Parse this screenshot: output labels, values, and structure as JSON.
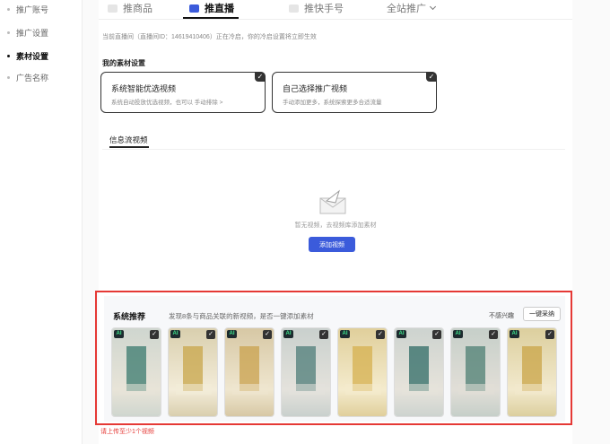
{
  "sidebar": {
    "items": [
      {
        "label": "推广账号",
        "active": false
      },
      {
        "label": "推广设置",
        "active": false
      },
      {
        "label": "素材设置",
        "active": true
      },
      {
        "label": "广告名称",
        "active": false
      }
    ]
  },
  "tabs": [
    {
      "label": "推商品",
      "active": false
    },
    {
      "label": "推直播",
      "active": true
    },
    {
      "label": "推快手号",
      "active": false
    },
    {
      "label": "全站推广",
      "active": false
    }
  ],
  "notice": "当前直播间（直播间ID：14619410406）正在冷启，你的冷启设置将立即生效",
  "material_section": {
    "title": "我的素材设置",
    "options": [
      {
        "title": "系统智能优选视频",
        "desc": "系统自动投放优选视频，也可以 手动排除 >",
        "checked": true
      },
      {
        "title": "自己选择推广视频",
        "desc": "手动添加更多，系统探索更多合适流量",
        "checked": true
      }
    ]
  },
  "feed": {
    "tab_label": "信息流视频",
    "empty_text": "暂无视频，去视频库添加素材",
    "add_button": "添加视频"
  },
  "recommend": {
    "title": "系统推荐",
    "desc": "发现8条与商品关联的新视频，是否一键添加素材",
    "ignore_label": "不感兴趣",
    "adopt_button": "一键采纳",
    "badge": "AI",
    "check": "✓",
    "thumbs": [
      {
        "bg": "#cfd6cf",
        "main": "#3a7a6e",
        "sub": "#e8e4d8"
      },
      {
        "bg": "#d9cfae",
        "main": "#c8a64a",
        "sub": "#f3ecd9"
      },
      {
        "bg": "#d7c8a5",
        "main": "#caa24e",
        "sub": "#efe6cf"
      },
      {
        "bg": "#c9d0cd",
        "main": "#4e7c78",
        "sub": "#e4e2dc"
      },
      {
        "bg": "#e0cf9b",
        "main": "#d6b04f",
        "sub": "#f4ebcd"
      },
      {
        "bg": "#cdd3cf",
        "main": "#2f6b66",
        "sub": "#e6e3db"
      },
      {
        "bg": "#c6cfc9",
        "main": "#4d7f73",
        "sub": "#e1ded7"
      },
      {
        "bg": "#dccf9e",
        "main": "#c9a447",
        "sub": "#f2e9cd"
      }
    ]
  },
  "warning": "请上传至少1个视频",
  "colors": {
    "accent": "#3b5bdb",
    "highlight": "#e53935"
  }
}
